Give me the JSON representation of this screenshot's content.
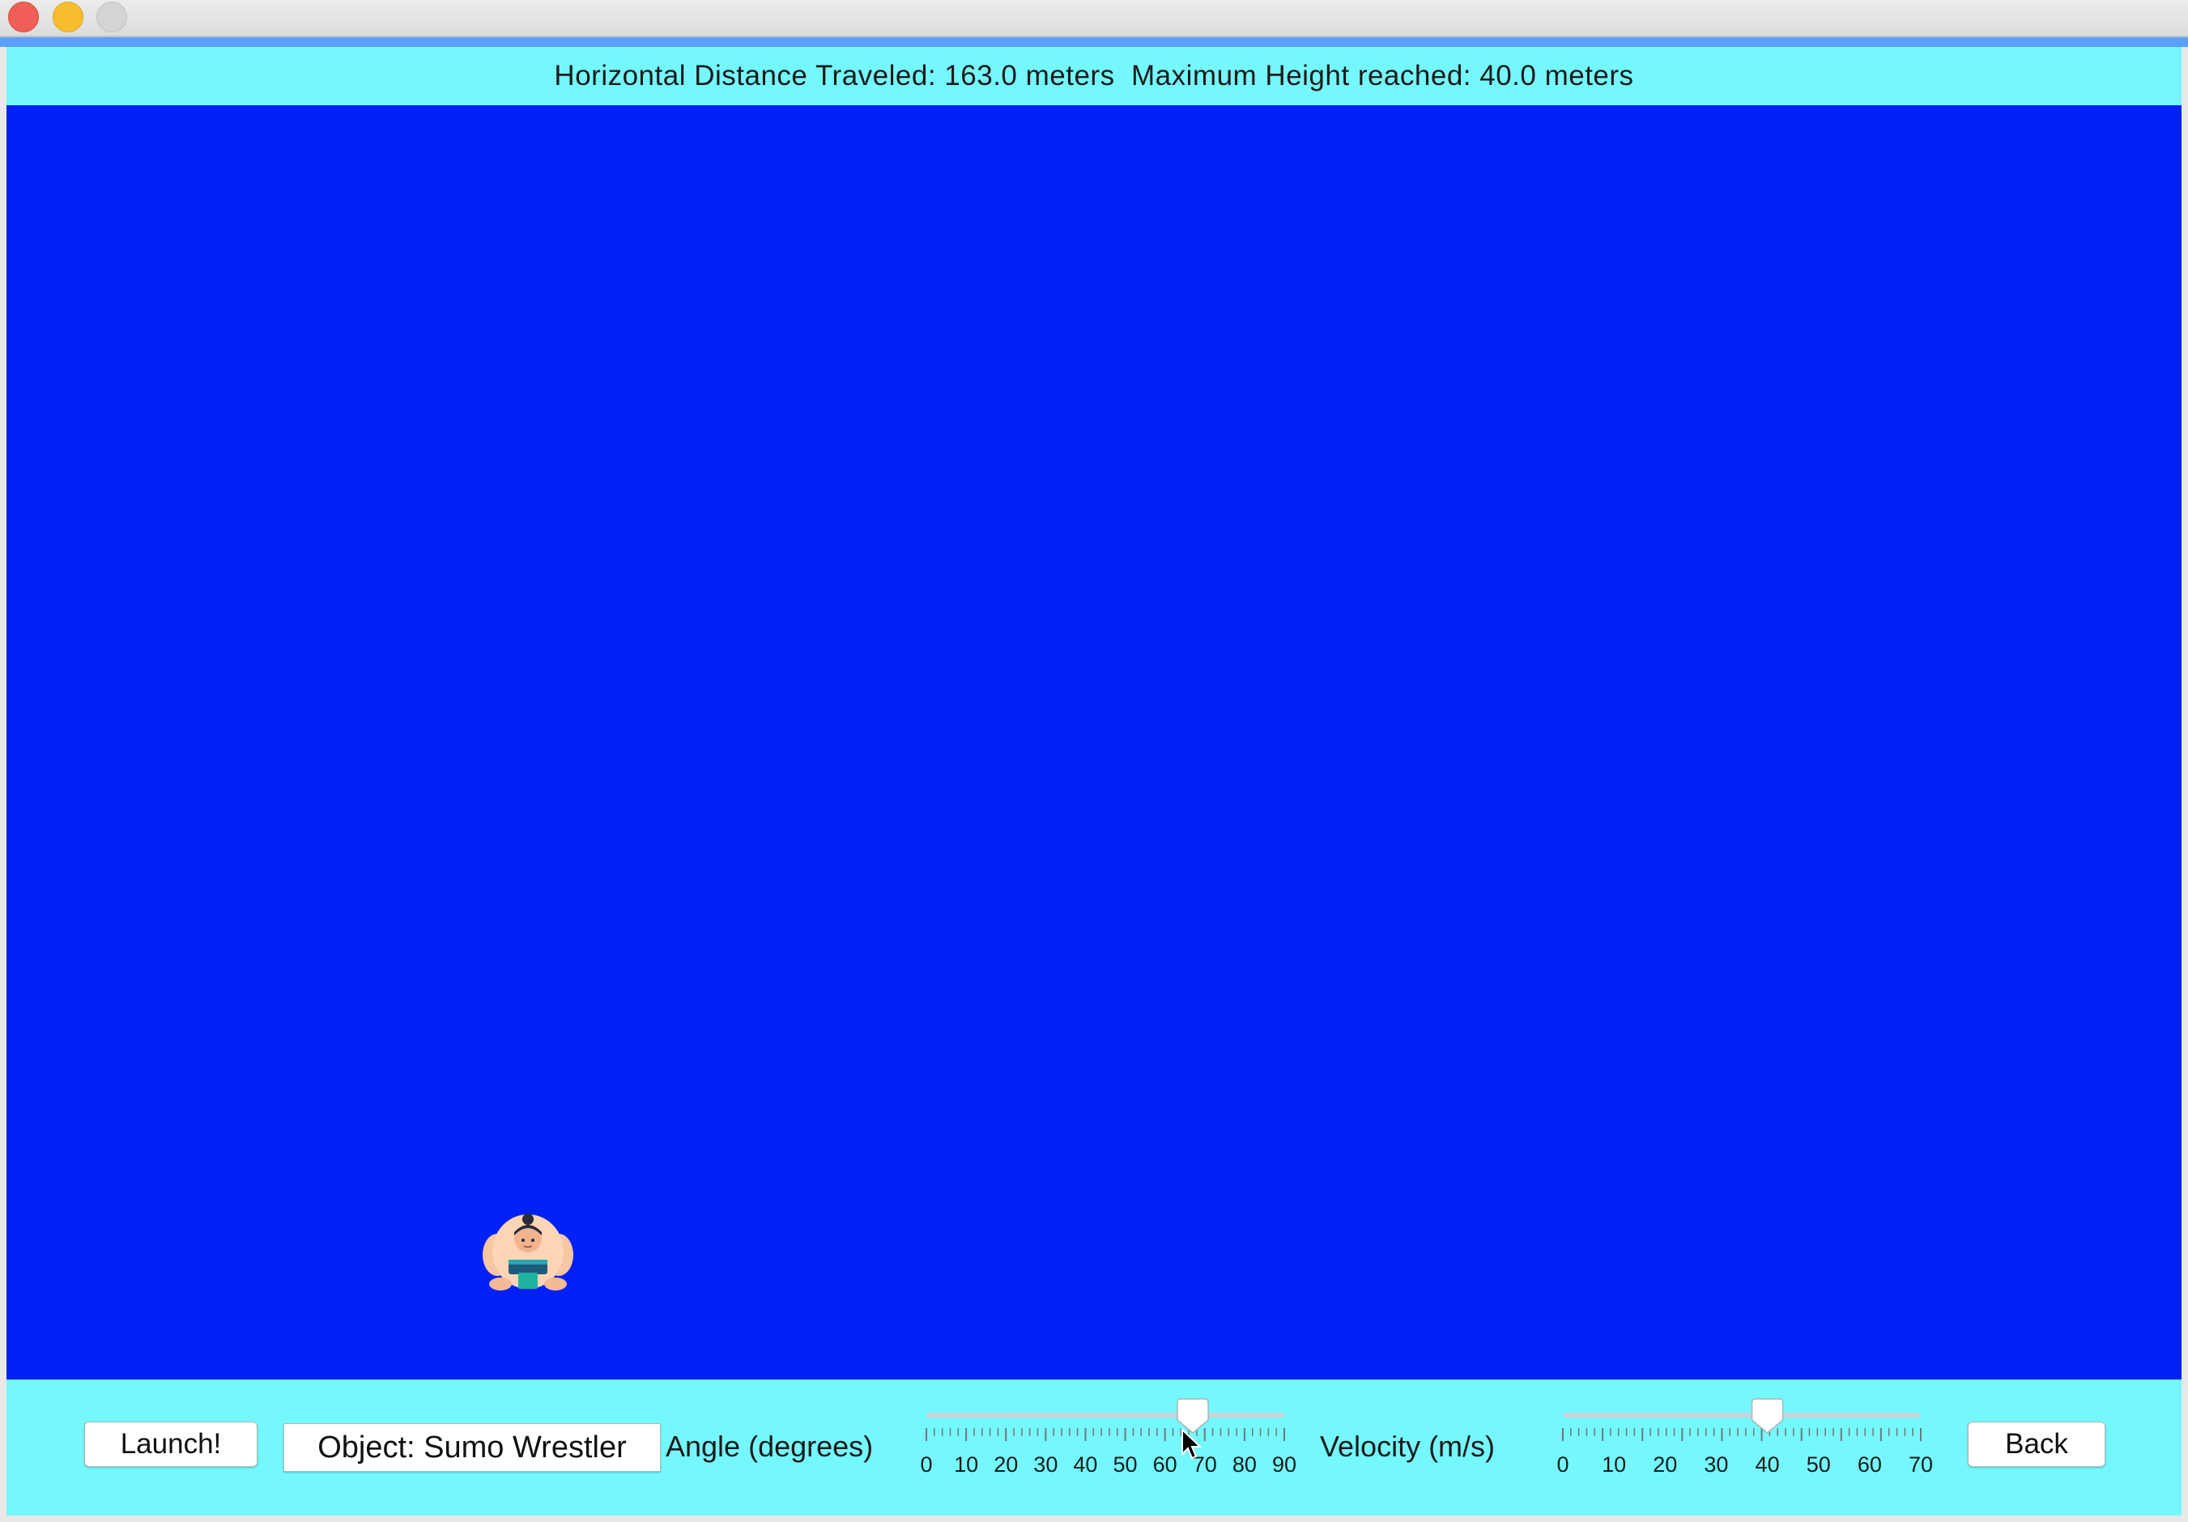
{
  "window": {
    "controls": [
      "close",
      "minimize",
      "zoom"
    ]
  },
  "info": {
    "text": "Horizontal Distance Traveled: 163.0 meters  Maximum Height reached: 40.0 meters"
  },
  "projectile": {
    "icon": "sumo-wrestler-icon"
  },
  "controls": {
    "launch_label": "Launch!",
    "object_label": "Object: Sumo Wrestler",
    "angle_label": "Angle (degrees)",
    "velocity_label": "Velocity (m/s)",
    "back_label": "Back",
    "angle_slider": {
      "min": 0,
      "max": 90,
      "value": 67,
      "ticks": [
        "0",
        "10",
        "20",
        "30",
        "40",
        "50",
        "60",
        "70",
        "80",
        "90"
      ]
    },
    "velocity_slider": {
      "min": 0,
      "max": 70,
      "value": 40,
      "ticks": [
        "0",
        "10",
        "20",
        "30",
        "40",
        "50",
        "60",
        "70"
      ]
    }
  },
  "colors": {
    "panel": "#74f8fd",
    "canvas": "#0021f6",
    "close": "#ef5f57",
    "minimize": "#f6be2f",
    "zoom": "#d4d4d4"
  }
}
